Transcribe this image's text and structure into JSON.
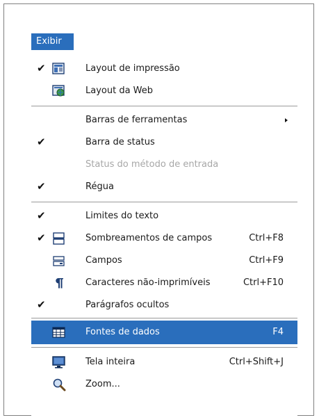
{
  "menu": {
    "title": "Exibir",
    "items": [
      {
        "label": "Layout de impressão",
        "checked": true,
        "icon": "print-layout-icon",
        "shortcut": ""
      },
      {
        "label": "Layout da Web",
        "checked": false,
        "icon": "web-layout-icon",
        "shortcut": ""
      },
      {
        "label": "Barras de ferramentas",
        "checked": false,
        "icon": "",
        "shortcut": "",
        "submenu": true
      },
      {
        "label": "Barra de status",
        "checked": true,
        "icon": "",
        "shortcut": ""
      },
      {
        "label": "Status do método de entrada",
        "checked": false,
        "icon": "",
        "shortcut": "",
        "disabled": true
      },
      {
        "label": "Régua",
        "checked": true,
        "icon": "",
        "shortcut": ""
      },
      {
        "label": "Limites do texto",
        "checked": true,
        "icon": "",
        "shortcut": ""
      },
      {
        "label": "Sombreamentos de campos",
        "checked": true,
        "icon": "field-shading-icon",
        "shortcut": "Ctrl+F8"
      },
      {
        "label": "Campos",
        "checked": false,
        "icon": "fields-icon",
        "shortcut": "Ctrl+F9"
      },
      {
        "label": "Caracteres não-imprimíveis",
        "checked": false,
        "icon": "pilcrow-icon",
        "shortcut": "Ctrl+F10"
      },
      {
        "label": "Parágrafos ocultos",
        "checked": true,
        "icon": "",
        "shortcut": ""
      },
      {
        "label": "Fontes de dados",
        "checked": false,
        "icon": "data-sources-icon",
        "shortcut": "F4",
        "selected": true
      },
      {
        "label": "Tela inteira",
        "checked": false,
        "icon": "full-screen-icon",
        "shortcut": "Ctrl+Shift+J"
      },
      {
        "label": "Zoom...",
        "checked": false,
        "icon": "zoom-icon",
        "shortcut": ""
      }
    ]
  },
  "colors": {
    "highlight": "#2a6ebc",
    "disabled": "#a7a7a7"
  }
}
